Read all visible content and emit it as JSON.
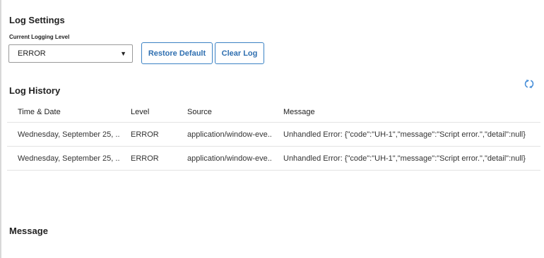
{
  "log_settings": {
    "title": "Log Settings",
    "level_label": "Current Logging Level",
    "level_value": "ERROR",
    "restore_label": "Restore Default",
    "clear_label": "Clear Log"
  },
  "log_history": {
    "title": "Log History",
    "refresh_icon": "refresh-icon",
    "columns": [
      "Time & Date",
      "Level",
      "Source",
      "Message"
    ],
    "rows": [
      {
        "time": "Wednesday, September 25, ...",
        "level": "ERROR",
        "source": "application/window-eve..",
        "message": "Unhandled Error: {\"code\":\"UH-1\",\"message\":\"Script error.\",\"detail\":null}"
      },
      {
        "time": "Wednesday, September 25, ...",
        "level": "ERROR",
        "source": "application/window-eve..",
        "message": "Unhandled Error: {\"code\":\"UH-1\",\"message\":\"Script error.\",\"detail\":null}"
      }
    ]
  },
  "message_section": {
    "title": "Message"
  },
  "colors": {
    "accent": "#3b82c4",
    "accent_text": "#2f6fb0",
    "border": "#e3e3e3"
  }
}
